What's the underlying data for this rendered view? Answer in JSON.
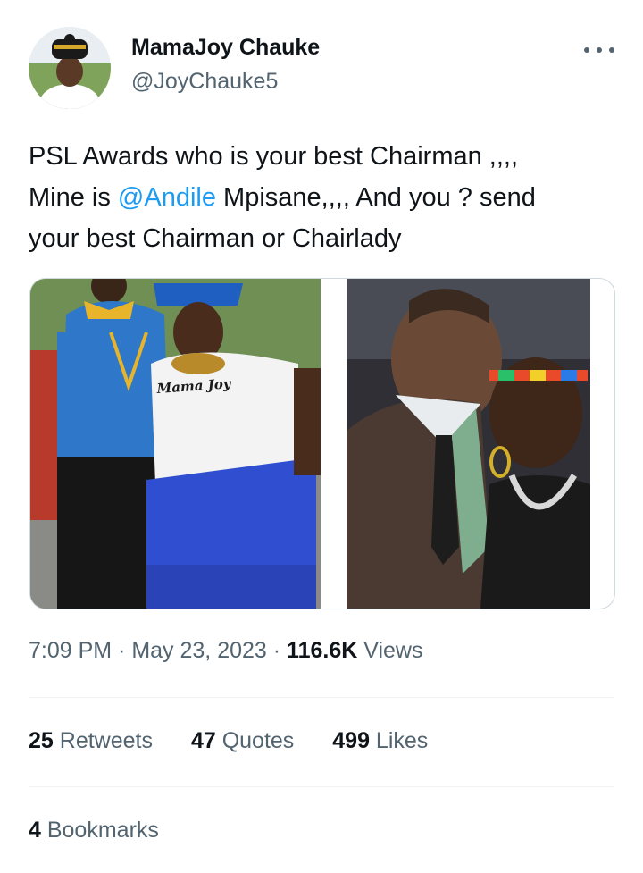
{
  "author": {
    "display_name": "MamaJoy Chauke",
    "handle": "@JoyChauke5"
  },
  "tweet": {
    "line1": "PSL Awards who is your best Chairman ,,,,",
    "line2_before": "Mine is ",
    "mention": "@Andile",
    "line2_after": " Mpisane,,,, And you ? send",
    "line3": "your best Chairman or Chairlady"
  },
  "media": {
    "left_photo_shirt_text": "Mama Joy"
  },
  "meta": {
    "time": "7:09 PM",
    "sep1": " · ",
    "date": "May 23, 2023",
    "sep2": " · ",
    "views_count": "116.6K",
    "views_label": " Views"
  },
  "stats": {
    "retweets_count": "25",
    "retweets_label": " Retweets",
    "quotes_count": "47",
    "quotes_label": " Quotes",
    "likes_count": "499",
    "likes_label": " Likes",
    "bookmarks_count": "4",
    "bookmarks_label": " Bookmarks"
  },
  "colors": {
    "link": "#1d9bf0",
    "secondary_text": "#536471",
    "primary_text": "#0f1419"
  }
}
